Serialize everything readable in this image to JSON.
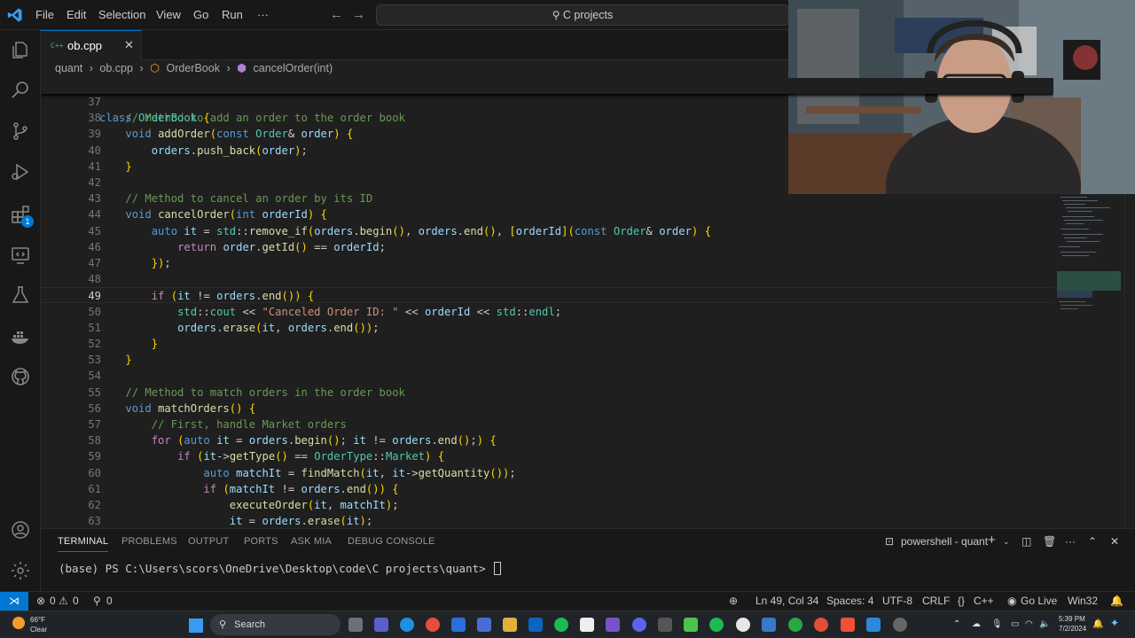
{
  "titlebar": {
    "menus": [
      "File",
      "Edit",
      "Selection",
      "View",
      "Go",
      "Run",
      "···"
    ],
    "search": "C projects"
  },
  "activity_bar": {
    "icons": [
      "explorer-icon",
      "search-icon",
      "source-control-icon",
      "run-debug-icon",
      "extensions-icon",
      "remote-explorer-icon",
      "testing-icon",
      "docker-icon",
      "github-icon",
      "account-icon",
      "settings-gear-icon"
    ],
    "extensions_badge": "1"
  },
  "tab": {
    "icon": "C++",
    "label": "ob.cpp"
  },
  "breadcrumb": [
    "quant",
    "ob.cpp",
    "OrderBook",
    "cancelOrder(int)"
  ],
  "editor": {
    "sticky": {
      "num": "7",
      "code": "class OrderBook {"
    },
    "lines": [
      {
        "num": "37",
        "code": ""
      },
      {
        "num": "38",
        "code": "    // Method to add an order to the order book"
      },
      {
        "num": "39",
        "code": "    void addOrder(const Order& order) {"
      },
      {
        "num": "40",
        "code": "        orders.push_back(order);"
      },
      {
        "num": "41",
        "code": "    }"
      },
      {
        "num": "42",
        "code": ""
      },
      {
        "num": "43",
        "code": "    // Method to cancel an order by its ID"
      },
      {
        "num": "44",
        "code": "    void cancelOrder(int orderId) {"
      },
      {
        "num": "45",
        "code": "        auto it = std::remove_if(orders.begin(), orders.end(), [orderId](const Order& order) {"
      },
      {
        "num": "46",
        "code": "            return order.getId() == orderId;"
      },
      {
        "num": "47",
        "code": "        });"
      },
      {
        "num": "48",
        "code": ""
      },
      {
        "num": "49",
        "code": "        if (it != orders.end()) {"
      },
      {
        "num": "50",
        "code": "            std::cout << \"Canceled Order ID: \" << orderId << std::endl;"
      },
      {
        "num": "51",
        "code": "            orders.erase(it, orders.end());"
      },
      {
        "num": "52",
        "code": "        }"
      },
      {
        "num": "53",
        "code": "    }"
      },
      {
        "num": "54",
        "code": ""
      },
      {
        "num": "55",
        "code": "    // Method to match orders in the order book"
      },
      {
        "num": "56",
        "code": "    void matchOrders() {"
      },
      {
        "num": "57",
        "code": "        // First, handle Market orders"
      },
      {
        "num": "58",
        "code": "        for (auto it = orders.begin(); it != orders.end();) {"
      },
      {
        "num": "59",
        "code": "            if (it->getType() == OrderType::Market) {"
      },
      {
        "num": "60",
        "code": "                auto matchIt = findMatch(it, it->getQuantity());"
      },
      {
        "num": "61",
        "code": "                if (matchIt != orders.end()) {"
      },
      {
        "num": "62",
        "code": "                    executeOrder(it, matchIt);"
      },
      {
        "num": "63",
        "code": "                    it = orders.erase(it);"
      }
    ],
    "current_line": "49"
  },
  "panel": {
    "tabs": [
      "TERMINAL",
      "PROBLEMS",
      "OUTPUT",
      "PORTS",
      "ASK MIA",
      "DEBUG CONSOLE"
    ],
    "terminal_name": "powershell - quant",
    "prompt": "(base) PS C:\\Users\\scors\\OneDrive\\Desktop\\code\\C projects\\quant> "
  },
  "statusbar": {
    "errors": "0",
    "warnings": "0",
    "ports": "0",
    "position": "Ln 49, Col 34",
    "spaces": "Spaces: 4",
    "encoding": "UTF-8",
    "eol": "CRLF",
    "language": "C++",
    "golive": "Go Live",
    "platform": "Win32"
  },
  "taskbar": {
    "weather_temp": "66°F",
    "weather_desc": "Clear",
    "search": "Search",
    "time": "5:39 PM",
    "date": "7/2/2024"
  },
  "colors": {
    "accent": "#0078d4",
    "keyword": "#569cd6",
    "comment": "#6a9955",
    "function": "#dcdcaa",
    "variable": "#9cdcfe",
    "type": "#4ec9b0",
    "string": "#ce9178"
  }
}
